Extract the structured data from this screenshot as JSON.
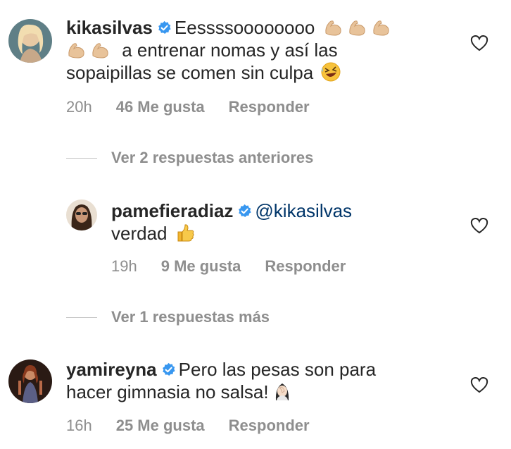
{
  "comments": [
    {
      "username": "kikasilvas",
      "text_line1": "Eessssoooooooo",
      "text_line2": "a entrenar nomas y así las",
      "text_line3": "sopaipillas se comen sin culpa",
      "time": "20h",
      "likes": "46 Me gusta",
      "reply": "Responder",
      "avatar_icon": "avatar-kikasilvas",
      "emojis": [
        "flexed-biceps",
        "flexed-biceps",
        "flexed-biceps",
        "flexed-biceps",
        "flexed-biceps",
        "rolling-laughing"
      ]
    },
    {
      "username": "pamefieradiaz",
      "mention": "@kikasilvas",
      "text": "verdad",
      "time": "19h",
      "likes": "9 Me gusta",
      "reply": "Responder",
      "avatar_icon": "avatar-pamefieradiaz",
      "emojis": [
        "thumbs-up"
      ]
    },
    {
      "username": "yamireyna",
      "text_line1": "Pero las pesas son para",
      "text_line2": "hacer gimnasia no salsa!",
      "time": "16h",
      "likes": "25 Me gusta",
      "reply": "Responder",
      "avatar_icon": "avatar-yamireyna",
      "emojis": [
        "woman-facepalming"
      ]
    }
  ],
  "view_previous": "Ver 2 respuestas anteriores",
  "view_more": "Ver 1 respuestas más",
  "colors": {
    "text": "#262626",
    "meta": "#8e8e8e",
    "verified": "#3897f0",
    "mention": "#003569"
  }
}
